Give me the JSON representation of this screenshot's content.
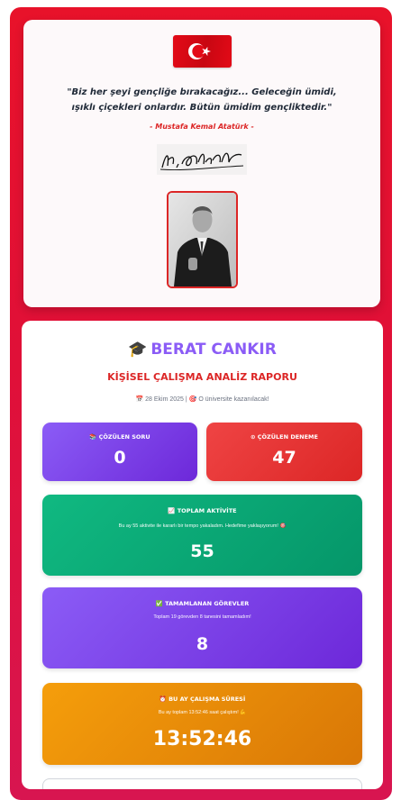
{
  "quote": {
    "text_line1": "\"Biz her şeyi gençliğe bırakacağız... Geleceğin ümidi,",
    "text_line2": "ışıklı çiçekleri onlardır. Bütün ümidim gençliktedir.\"",
    "author": "- Mustafa Kemal Atatürk -",
    "flag_icon": "turkish-flag-icon"
  },
  "profile": {
    "name": "BERAT CANKIR",
    "cap_icon": "🎓",
    "report_title": "KİŞİSEL ÇALIŞMA ANALİZ RAPORU",
    "date_icon": "📅",
    "date": "28 Ekim 2025",
    "separator": "|",
    "goal_icon": "🎯",
    "goal": "O üniversite kazanılacak!"
  },
  "stats": {
    "solved": {
      "icon": "📚",
      "label": "ÇÖZÜLEN SORU",
      "value": "0"
    },
    "exams": {
      "icon": "⊙",
      "label": "ÇÖZÜLEN DENEME",
      "value": "47"
    },
    "activity": {
      "icon": "📈",
      "label": "TOPLAM AKTİVİTE",
      "desc": "Bu ay 55 aktivite ile kararlı bir tempo yakaladım. Hedefime yaklaşıyorum! 🎯",
      "value": "55"
    },
    "tasks": {
      "icon": "✅",
      "label": "TAMAMLANAN GÖREVLER",
      "desc": "Toplam 19 görevden 8 tanesini tamamladım!",
      "value": "8"
    },
    "time": {
      "icon": "⏰",
      "label": "BU AY ÇALIŞMA SÜRESİ",
      "desc": "Bu ay toplam 13:52:46 saat çalıştım! 💪",
      "value": "13:52:46"
    }
  },
  "colors": {
    "frame_red": "#e8122a",
    "accent_purple": "#8b5cf6",
    "accent_red": "#dc2626",
    "green": "#10b981",
    "orange": "#f59e0b"
  }
}
